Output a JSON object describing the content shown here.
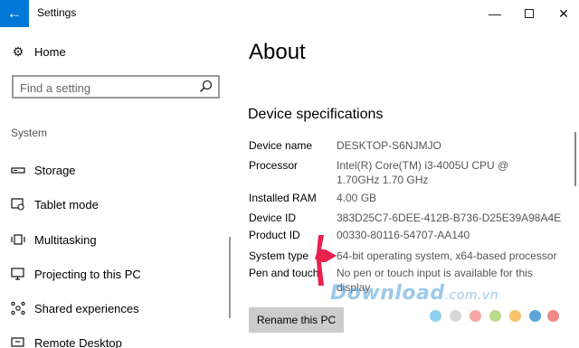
{
  "window": {
    "title": "Settings",
    "back_icon": "back-arrow-icon",
    "minimize_glyph": "—",
    "close_glyph": "✕"
  },
  "sidebar": {
    "home_label": "Home",
    "search_placeholder": "Find a setting",
    "section_label": "System",
    "items": [
      {
        "label": "Storage",
        "icon": "storage-icon"
      },
      {
        "label": "Tablet mode",
        "icon": "tablet-mode-icon"
      },
      {
        "label": "Multitasking",
        "icon": "multitasking-icon"
      },
      {
        "label": "Projecting to this PC",
        "icon": "projecting-icon"
      },
      {
        "label": "Shared experiences",
        "icon": "shared-experiences-icon"
      },
      {
        "label": "Remote Desktop",
        "icon": "remote-desktop-icon"
      }
    ]
  },
  "main": {
    "title": "About",
    "section_title": "Device specifications",
    "specs": [
      {
        "label": "Device name",
        "value": "DESKTOP-S6NJMJO"
      },
      {
        "label": "Processor",
        "value": "Intel(R) Core(TM) i3-4005U CPU @ 1.70GHz 1.70 GHz"
      },
      {
        "label": "Installed RAM",
        "value": "4.00 GB"
      },
      {
        "label": "Device ID",
        "value": "383D25C7-6DEE-412B-B736-D25E39A98A4E"
      },
      {
        "label": "Product ID",
        "value": "00330-80116-54707-AA140"
      },
      {
        "label": "System type",
        "value": "64-bit operating system, x64-based processor"
      },
      {
        "label": "Pen and touch",
        "value": "No pen or touch input is available for this display"
      }
    ],
    "rename_button": "Rename this PC"
  },
  "watermark": {
    "text": "Download",
    "suffix": ".com.vn",
    "dot_colors": [
      "#8fd0f0",
      "#d6d6d6",
      "#f7a6a6",
      "#b9db8b",
      "#f6c36b",
      "#5ba6d9",
      "#f08a8a"
    ]
  },
  "colors": {
    "accent": "#0078d7",
    "arrow": "#e8214f"
  }
}
